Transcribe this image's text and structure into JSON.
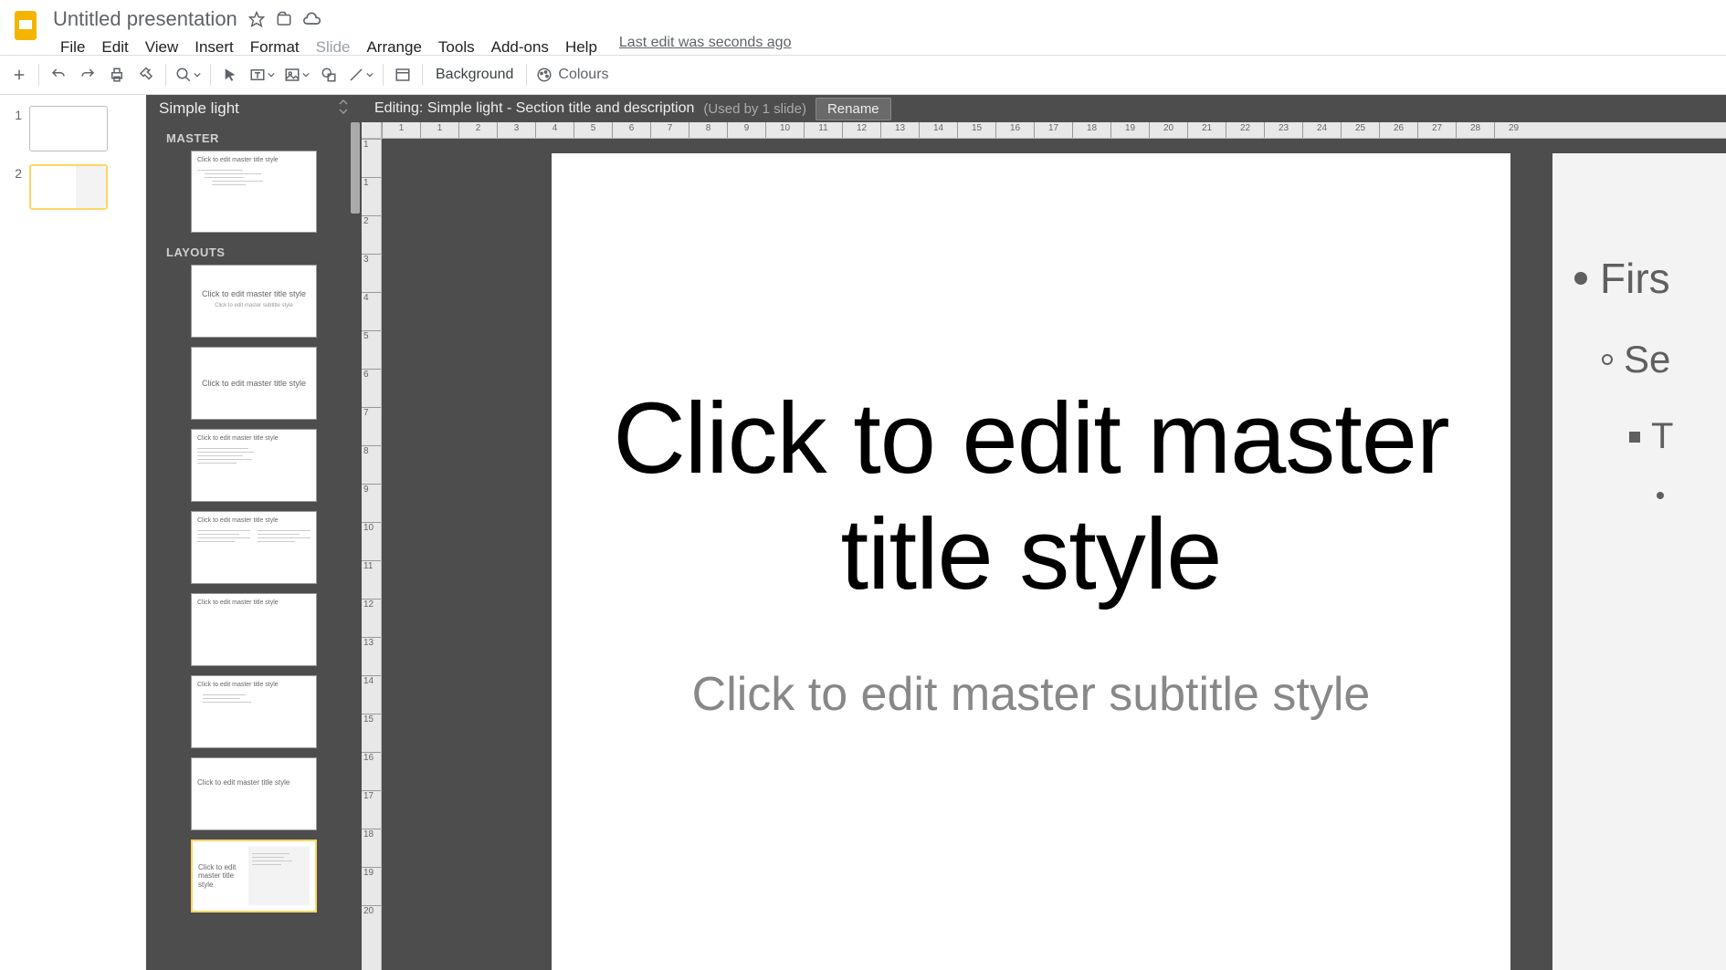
{
  "header": {
    "doc_title": "Untitled presentation",
    "last_edit": "Last edit was seconds ago"
  },
  "menubar": [
    {
      "label": "File",
      "disabled": false
    },
    {
      "label": "Edit",
      "disabled": false
    },
    {
      "label": "View",
      "disabled": false
    },
    {
      "label": "Insert",
      "disabled": false
    },
    {
      "label": "Format",
      "disabled": false
    },
    {
      "label": "Slide",
      "disabled": true
    },
    {
      "label": "Arrange",
      "disabled": false
    },
    {
      "label": "Tools",
      "disabled": false
    },
    {
      "label": "Add-ons",
      "disabled": false
    },
    {
      "label": "Help",
      "disabled": false
    }
  ],
  "toolbar": {
    "background_label": "Background",
    "colours_label": "Colours"
  },
  "slide_thumbs": [
    {
      "num": "1",
      "selected": false
    },
    {
      "num": "2",
      "selected": true
    }
  ],
  "theme_panel": {
    "theme_name": "Simple light",
    "master_label": "MASTER",
    "layouts_label": "LAYOUTS",
    "master_thumb_text": "Click to edit master title style",
    "layouts": [
      {
        "type": "title-center",
        "title": "Click to edit master title style",
        "sub": "Click to edit master subtitle style",
        "selected": false
      },
      {
        "type": "title-middle",
        "title": "Click to edit master title style",
        "selected": false
      },
      {
        "type": "title-top-lines",
        "title": "Click to edit master title style",
        "selected": false
      },
      {
        "type": "title-top-two-col",
        "title": "Click to edit master title style",
        "selected": false
      },
      {
        "type": "title-top-blank",
        "title": "Click to edit master title style",
        "selected": false
      },
      {
        "type": "title-top-indent",
        "title": "Click to edit master title style",
        "selected": false
      },
      {
        "type": "title-left",
        "title": "Click to edit master title style",
        "selected": false
      },
      {
        "type": "section-desc",
        "title": "Click to edit master title style",
        "selected": true
      }
    ]
  },
  "info_bar": {
    "editing_label": "Editing: Simple light - Section title and description",
    "usage_label": "(Used by 1 slide)",
    "rename_label": "Rename"
  },
  "ruler_top": [
    "1",
    "1",
    "2",
    "3",
    "4",
    "5",
    "6",
    "7",
    "8",
    "9",
    "10",
    "11",
    "12",
    "13",
    "14",
    "15",
    "16",
    "17",
    "18",
    "19",
    "20",
    "21",
    "22",
    "23",
    "24",
    "25",
    "26",
    "27",
    "28",
    "29"
  ],
  "ruler_left": [
    "1",
    "1",
    "2",
    "3",
    "4",
    "5",
    "6",
    "7",
    "8",
    "9",
    "10",
    "11",
    "12",
    "13",
    "14",
    "15",
    "16",
    "17",
    "18",
    "19",
    "20"
  ],
  "canvas": {
    "title": "Click to edit master title style",
    "subtitle": "Click to edit master subtitle style",
    "peek_items": [
      "Firs",
      "Se",
      "T",
      ""
    ]
  }
}
